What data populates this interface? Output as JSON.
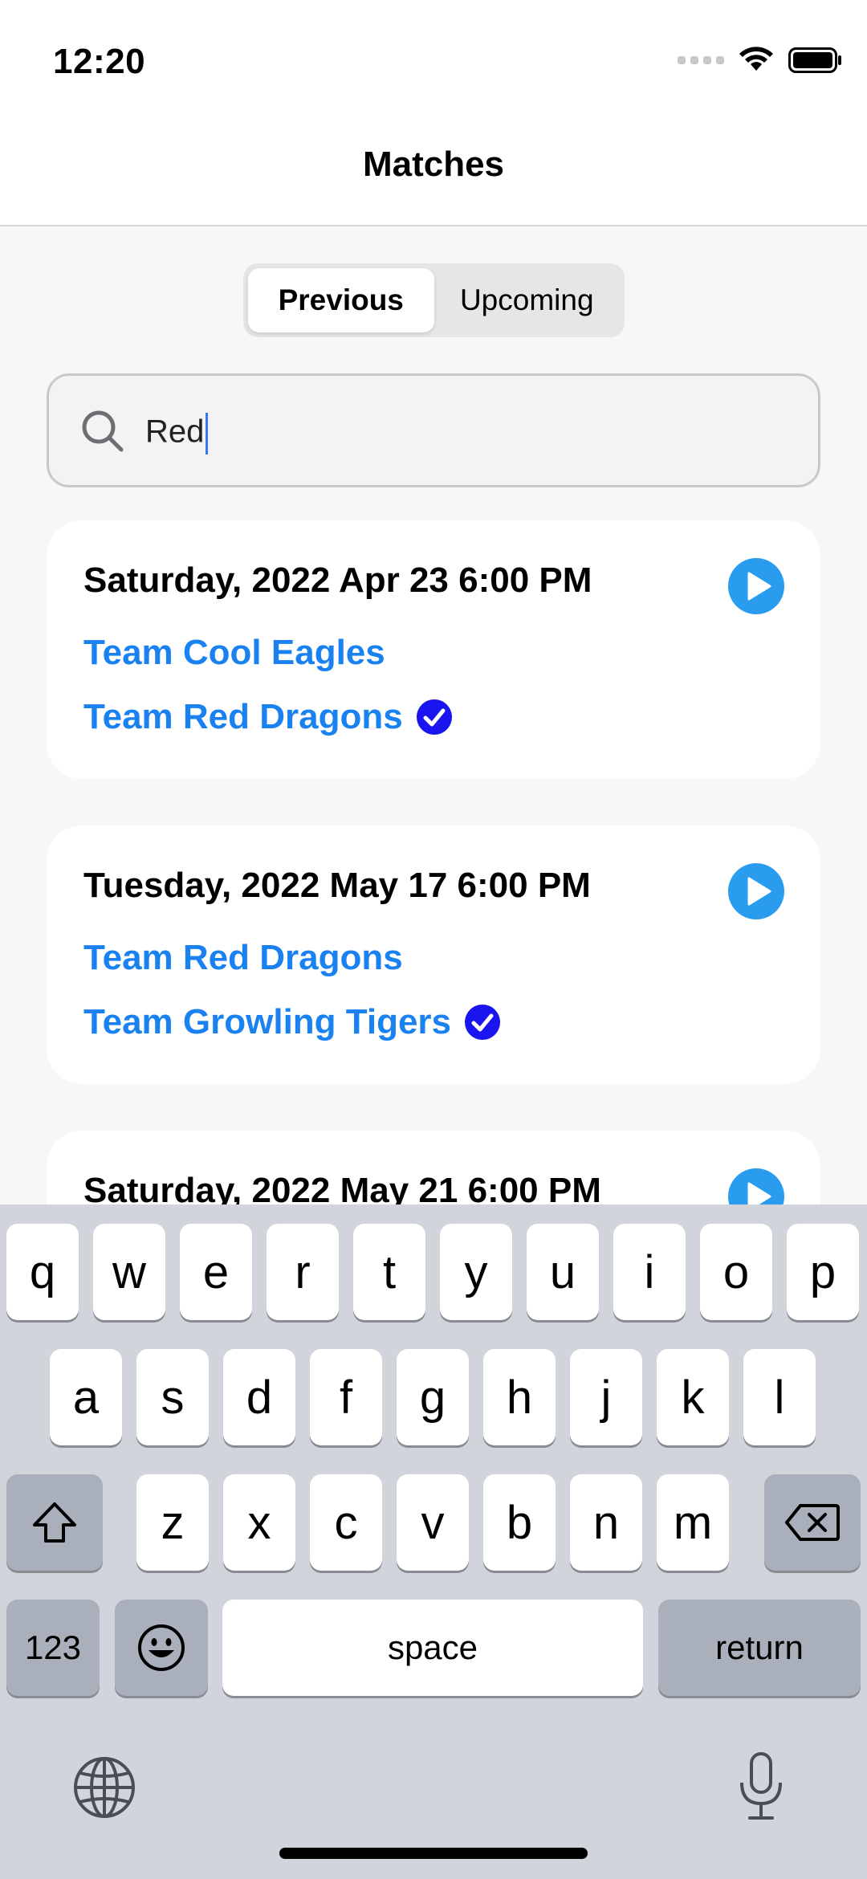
{
  "status_bar": {
    "time": "12:20"
  },
  "nav": {
    "title": "Matches"
  },
  "segments": {
    "previous": "Previous",
    "upcoming": "Upcoming",
    "selected": "Previous"
  },
  "search": {
    "value": "Red"
  },
  "matches": [
    {
      "date": "Saturday, 2022 Apr 23 6:00 PM",
      "team_a": "Team Cool Eagles",
      "team_b": "Team Red Dragons",
      "winner": "team_b"
    },
    {
      "date": "Tuesday, 2022 May 17 6:00 PM",
      "team_a": "Team Red Dragons",
      "team_b": "Team Growling Tigers",
      "winner": "team_b"
    },
    {
      "date": "Saturday, 2022 May 21 6:00 PM"
    }
  ],
  "keyboard": {
    "row1": [
      "q",
      "w",
      "e",
      "r",
      "t",
      "y",
      "u",
      "i",
      "o",
      "p"
    ],
    "row2": [
      "a",
      "s",
      "d",
      "f",
      "g",
      "h",
      "j",
      "k",
      "l"
    ],
    "row3": [
      "z",
      "x",
      "c",
      "v",
      "b",
      "n",
      "m"
    ],
    "numbers_key": "123",
    "space_key": "space",
    "return_key": "return"
  },
  "colors": {
    "accent": "#1A82F0",
    "check": "#1A14EE",
    "play": "#2A9CF0"
  },
  "icons": [
    "wifi-icon",
    "battery-icon",
    "search-icon",
    "play-icon",
    "checkmark-icon",
    "shift-icon",
    "delete-icon",
    "emoji-icon",
    "globe-icon",
    "microphone-icon"
  ]
}
